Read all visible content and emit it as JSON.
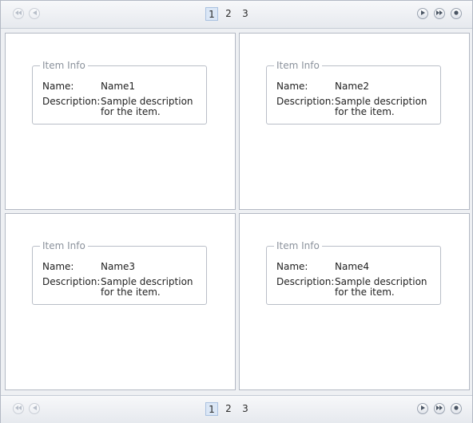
{
  "pager": {
    "pages": [
      "1",
      "2",
      "3"
    ],
    "active_page": "1",
    "icons": {
      "first": "first-page-icon",
      "prev": "previous-page-icon",
      "next": "next-page-icon",
      "last": "last-page-icon",
      "end": "end-icon"
    }
  },
  "cards": [
    {
      "group_title": "Item Info",
      "name_label": "Name:",
      "name_value": "Name1",
      "desc_label": "Description:",
      "desc_value": "Sample description for the item."
    },
    {
      "group_title": "Item Info",
      "name_label": "Name:",
      "name_value": "Name2",
      "desc_label": "Description:",
      "desc_value": "Sample description for the item."
    },
    {
      "group_title": "Item Info",
      "name_label": "Name:",
      "name_value": "Name3",
      "desc_label": "Description:",
      "desc_value": "Sample description for the item."
    },
    {
      "group_title": "Item Info",
      "name_label": "Name:",
      "name_value": "Name4",
      "desc_label": "Description:",
      "desc_value": "Sample description for the item."
    }
  ],
  "colors": {
    "accent": "#dbe7f6",
    "border": "#b3b9c4",
    "legend_text": "#8b929c"
  }
}
